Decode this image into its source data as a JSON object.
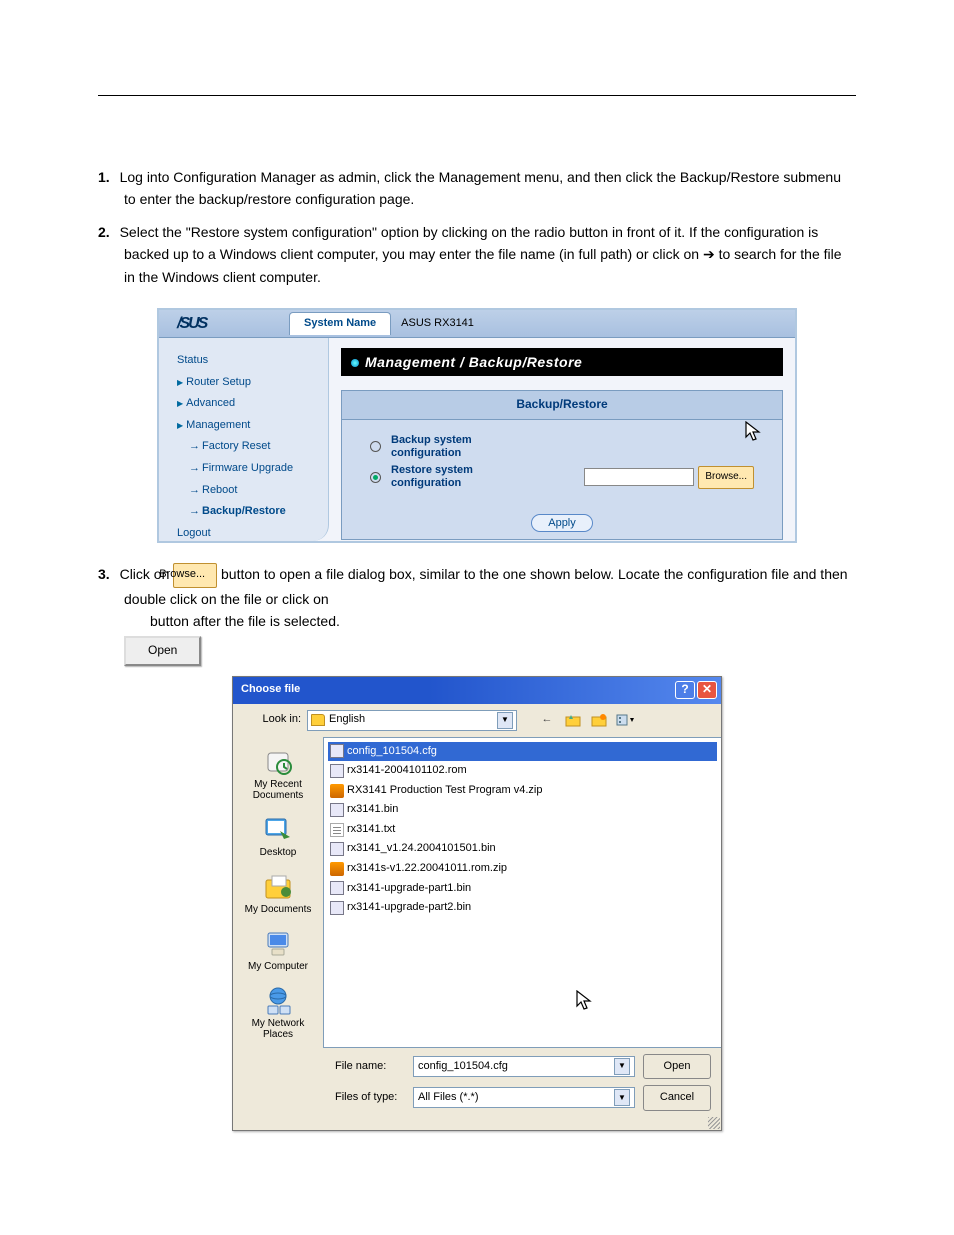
{
  "doc": {
    "step1_num": "1.",
    "step1_text": "Log into Configuration Manager as admin, click the Management menu, and then click the Backup/Restore submenu to enter the backup/restore configuration page.",
    "step2_num": "2.",
    "step2_text_part1": "Select the \"Restore system configuration\" option by clicking on the radio button in front of it. If the configuration is backed up to a Windows client computer, you may enter the file name (in full path) or click on ",
    "step2_text_part2": " to search for the file in the Windows client computer.",
    "step3_num": "3.",
    "step3_text_part1": "Click on ",
    "step3_text_part2": " button to open a file dialog box, similar to the one shown below. Locate the configuration file and then double click on the file or click on ",
    "step3_text_part3": " button after the file is selected.",
    "arrow_symbol": "➔",
    "browse_btn_label": "Browse...",
    "open_btn_label": "Open"
  },
  "router": {
    "logo_text": "/SUS",
    "tab_label": "System Name",
    "system_name_value": "ASUS RX3141",
    "page_title": "Management / Backup/Restore",
    "panel_header": "Backup/Restore",
    "option_backup": "Backup system configuration",
    "option_restore": "Restore system configuration",
    "browse_label": "Browse...",
    "apply_label": "Apply",
    "sidebar": {
      "status": "Status",
      "router_setup": "Router Setup",
      "advanced": "Advanced",
      "management": "Management",
      "factory_reset": "Factory Reset",
      "firmware_upgrade": "Firmware Upgrade",
      "reboot": "Reboot",
      "backup_restore": "Backup/Restore",
      "logout": "Logout"
    }
  },
  "dlg": {
    "title": "Choose file",
    "lookin_label": "Look in:",
    "lookin_value": "English",
    "places": {
      "recent": "My Recent Documents",
      "desktop": "Desktop",
      "documents": "My Documents",
      "computer": "My Computer",
      "network": "My Network Places"
    },
    "files": [
      {
        "name": "config_101504.cfg",
        "icon": "cfg",
        "selected": true
      },
      {
        "name": "rx3141-2004101102.rom",
        "icon": "rom"
      },
      {
        "name": "RX3141 Production Test Program v4.zip",
        "icon": "zip"
      },
      {
        "name": "rx3141.bin",
        "icon": "bin"
      },
      {
        "name": "rx3141.txt",
        "icon": "txt"
      },
      {
        "name": "rx3141_v1.24.2004101501.bin",
        "icon": "bin"
      },
      {
        "name": "rx3141s-v1.22.20041011.rom.zip",
        "icon": "zip"
      },
      {
        "name": "rx3141-upgrade-part1.bin",
        "icon": "bin"
      },
      {
        "name": "rx3141-upgrade-part2.bin",
        "icon": "bin"
      }
    ],
    "filename_label": "File name:",
    "filename_value": "config_101504.cfg",
    "filetype_label": "Files of type:",
    "filetype_value": "All Files (*.*)",
    "open_btn": "Open",
    "cancel_btn": "Cancel"
  }
}
